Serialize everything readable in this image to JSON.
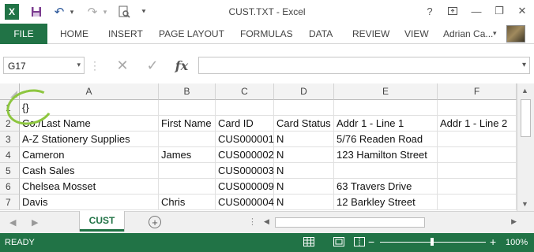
{
  "window": {
    "title": "CUST.TXT - Excel",
    "help": "?",
    "restore_icon": "restore-icon",
    "minimize": "—",
    "maximize": "❐",
    "close": "✕"
  },
  "qat": {
    "excel_logo": "X",
    "save": "💾",
    "undo": "↶",
    "undo_caret": "▾",
    "redo": "↷",
    "redo_caret": "▾",
    "preview": "🔍",
    "customize": "⯆"
  },
  "ribbon": {
    "file_label": "FILE",
    "tabs": [
      "HOME",
      "INSERT",
      "PAGE LAYOUT",
      "FORMULAS",
      "DATA",
      "REVIEW",
      "VIEW"
    ],
    "user": "Adrian Ca...",
    "user_caret": "▾"
  },
  "formula_bar": {
    "name_box": "G17",
    "name_box_caret": "▾",
    "cancel": "✕",
    "enter": "✓",
    "fx": "fx",
    "formula": "",
    "expand": "▾"
  },
  "grid": {
    "columns": [
      "A",
      "B",
      "C",
      "D",
      "E",
      "F"
    ],
    "rows": [
      {
        "num": "1",
        "cells": [
          "{}",
          "",
          "",
          "",
          "",
          ""
        ]
      },
      {
        "num": "2",
        "cells": [
          "Co./Last Name",
          "First Name",
          "Card ID",
          "Card Status",
          "Addr 1 - Line 1",
          "Addr 1 - Line 2"
        ]
      },
      {
        "num": "3",
        "cells": [
          "A-Z Stationery Supplies",
          "",
          "CUS000001",
          "N",
          "5/76 Readen Road",
          ""
        ]
      },
      {
        "num": "4",
        "cells": [
          "Cameron",
          "James",
          "CUS000002",
          "N",
          "123 Hamilton Street",
          ""
        ]
      },
      {
        "num": "5",
        "cells": [
          "Cash Sales",
          "",
          "CUS000003",
          "N",
          "",
          ""
        ]
      },
      {
        "num": "6",
        "cells": [
          "Chelsea Mosset",
          "",
          "CUS000009",
          "N",
          "63 Travers Drive",
          ""
        ]
      },
      {
        "num": "7",
        "cells": [
          "Davis",
          "Chris",
          "CUS000004",
          "N",
          "12 Barkley Street",
          ""
        ]
      }
    ]
  },
  "sheets": {
    "nav_prev": "◀",
    "nav_next": "▶",
    "tabs": [
      "CUST"
    ],
    "add": "+",
    "more": "⋮"
  },
  "status": {
    "text": "READY",
    "zoom_minus": "−",
    "zoom_plus": "+",
    "zoom_level": "100%"
  },
  "colors": {
    "accent": "#217346",
    "annotation_circle": "#8dc63f"
  }
}
